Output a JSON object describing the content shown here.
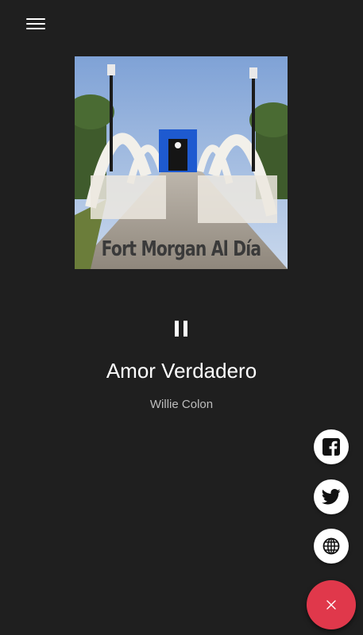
{
  "album": {
    "caption": "Fort Morgan Al Día"
  },
  "track": {
    "title": "Amor Verdadero",
    "artist": "Willie Colon"
  },
  "colors": {
    "background": "#1f1f1f",
    "fab_accent": "#e0384b",
    "social_bg": "#ffffff"
  },
  "icons": {
    "menu": "hamburger-icon",
    "playback": "pause-icon",
    "social": [
      "facebook-icon",
      "twitter-icon",
      "globe-icon"
    ],
    "fab": "close-icon"
  }
}
